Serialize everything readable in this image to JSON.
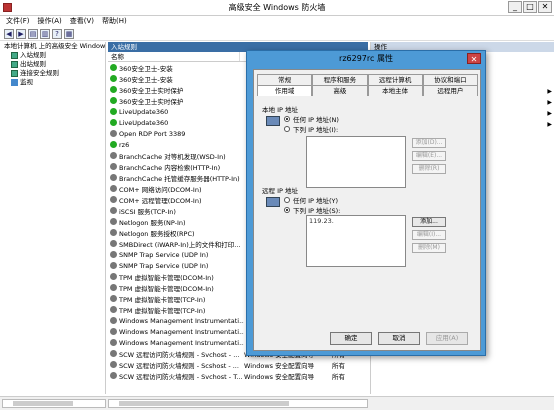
{
  "window": {
    "title": "高级安全 Windows 防火墙",
    "controls": [
      "_",
      "□",
      "✕"
    ]
  },
  "menu": [
    "文件(F)",
    "操作(A)",
    "查看(V)",
    "帮助(H)"
  ],
  "toolbar": [
    "◀",
    "▶",
    "▤",
    "▥",
    "?",
    "▦"
  ],
  "tree": {
    "root": "本地计算机 上的高级安全 Windows 防火墙",
    "items": [
      "入站规则",
      "出站规则",
      "连接安全规则",
      "监视"
    ]
  },
  "list": {
    "pane_title": "入站规则",
    "columns": [
      "名称",
      "",
      ""
    ],
    "rows": [
      {
        "name": "360安全卫士-安装",
        "enabled": true,
        "group": "",
        "profile": ""
      },
      {
        "name": "360安全卫士-安装",
        "enabled": true,
        "group": "",
        "profile": ""
      },
      {
        "name": "360安全卫士实时保护",
        "enabled": true,
        "group": "",
        "profile": ""
      },
      {
        "name": "360安全卫士实时保护",
        "enabled": true,
        "group": "",
        "profile": ""
      },
      {
        "name": "LiveUpdate360",
        "enabled": true,
        "group": "",
        "profile": ""
      },
      {
        "name": "LiveUpdate360",
        "enabled": true,
        "group": "",
        "profile": ""
      },
      {
        "name": "Open RDP Port 3389",
        "enabled": false,
        "group": "",
        "profile": ""
      },
      {
        "name": "rz6",
        "enabled": true,
        "group": "",
        "profile": ""
      },
      {
        "name": "BranchCache 对等机发现(WSD-In)",
        "enabled": false,
        "group": "",
        "profile": ""
      },
      {
        "name": "BranchCache 内容检索(HTTP-In)",
        "enabled": false,
        "group": "",
        "profile": ""
      },
      {
        "name": "BranchCache 托管缓存服务器(HTTP-In)",
        "enabled": false,
        "group": "",
        "profile": ""
      },
      {
        "name": "COM+ 网络访问(DCOM-In)",
        "enabled": false,
        "group": "",
        "profile": ""
      },
      {
        "name": "COM+ 远程管理(DCOM-In)",
        "enabled": false,
        "group": "",
        "profile": ""
      },
      {
        "name": "iSCSI 服务(TCP-In)",
        "enabled": false,
        "group": "",
        "profile": ""
      },
      {
        "name": "Netlogon 服务(NP-In)",
        "enabled": false,
        "group": "",
        "profile": ""
      },
      {
        "name": "Netlogon 服务授权(RPC)",
        "enabled": false,
        "group": "",
        "profile": ""
      },
      {
        "name": "SMBDirect (iWARP-In)上的文件和打印...",
        "enabled": false,
        "group": "",
        "profile": ""
      },
      {
        "name": "SNMP Trap Service (UDP In)",
        "enabled": false,
        "group": "",
        "profile": ""
      },
      {
        "name": "SNMP Trap Service (UDP In)",
        "enabled": false,
        "group": "",
        "profile": ""
      },
      {
        "name": "TPM 虚拟智能卡管理(DCOM-In)",
        "enabled": false,
        "group": "",
        "profile": ""
      },
      {
        "name": "TPM 虚拟智能卡管理(DCOM-In)",
        "enabled": false,
        "group": "",
        "profile": ""
      },
      {
        "name": "TPM 虚拟智能卡管理(TCP-In)",
        "enabled": false,
        "group": "",
        "profile": ""
      },
      {
        "name": "TPM 虚拟智能卡管理(TCP-In)",
        "enabled": false,
        "group": "",
        "profile": ""
      },
      {
        "name": "Windows Management Instrumentati...",
        "enabled": false,
        "group": "",
        "profile": ""
      },
      {
        "name": "Windows Management Instrumentati...",
        "enabled": false,
        "group": "",
        "profile": ""
      },
      {
        "name": "Windows Management Instrumentati...",
        "enabled": false,
        "group": "",
        "profile": ""
      },
      {
        "name": "SCW 远程访问防火墙规则 - Svchost - ...",
        "enabled": false,
        "group": "Windows 安全配置向导",
        "profile": "所有"
      },
      {
        "name": "SCW 远程访问防火墙规则 - Scshost - ...",
        "enabled": false,
        "group": "Windows 安全配置向导",
        "profile": "所有"
      },
      {
        "name": "SCW 远程访问防火墙规则 - Svchost - T...",
        "enabled": false,
        "group": "Windows 安全配置向导",
        "profile": "所有"
      }
    ]
  },
  "actions": {
    "pane_title": "操作",
    "arrows": [
      "▶",
      "▶",
      "▶",
      "▶"
    ]
  },
  "dialog": {
    "title": "rz6297rc 属性",
    "close": "✕",
    "tabs_row1": [
      "常规",
      "程序和服务",
      "远程计算机",
      "协议和端口"
    ],
    "tabs_row2": [
      "作用域",
      "高级",
      "本地主体",
      "远程用户"
    ],
    "local_group": {
      "label": "本地 IP 地址",
      "radio_any": "任何 IP 地址(N)",
      "radio_list": "下列 IP 地址(I):",
      "selected": "any",
      "entries": [],
      "buttons": [
        "添加(D)...",
        "编辑(E)...",
        "删除(R)"
      ]
    },
    "remote_group": {
      "label": "远程 IP 地址",
      "radio_any": "任何 IP 地址(Y)",
      "radio_list": "下列 IP 地址(S):",
      "selected": "list",
      "entries": [
        "119.23."
      ],
      "buttons": [
        "添加...",
        "编辑(I)...",
        "删除(M)"
      ]
    },
    "buttons": {
      "ok": "确定",
      "cancel": "取消",
      "apply": "应用(A)"
    }
  }
}
